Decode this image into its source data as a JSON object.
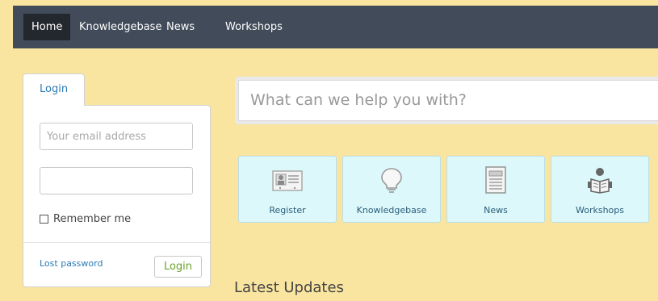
{
  "nav": {
    "items": [
      {
        "label": "Home",
        "active": true
      },
      {
        "label": "Knowledgebase",
        "active": false
      },
      {
        "label": "News",
        "active": false
      },
      {
        "label": "Workshops",
        "active": false
      }
    ]
  },
  "login": {
    "tab_label": "Login",
    "email_placeholder": "Your email address",
    "password_value": "",
    "remember_label": "Remember me",
    "remember_checked": false,
    "lost_password_label": "Lost password",
    "submit_label": "Login"
  },
  "search": {
    "placeholder": "What can we help you with?"
  },
  "tiles": [
    {
      "label": "Register",
      "icon": "id-card-icon"
    },
    {
      "label": "Knowledgebase",
      "icon": "lightbulb-icon"
    },
    {
      "label": "News",
      "icon": "newspaper-icon"
    },
    {
      "label": "Workshops",
      "icon": "reader-icon"
    }
  ],
  "latest_updates": {
    "heading": "Latest Updates"
  },
  "colors": {
    "background": "#f9e4a0",
    "navbar": "#414b59",
    "nav_active": "#23272e",
    "link": "#2a7bb5",
    "tile_bg": "#dcf8fb",
    "login_button_text": "#6aa32a"
  }
}
